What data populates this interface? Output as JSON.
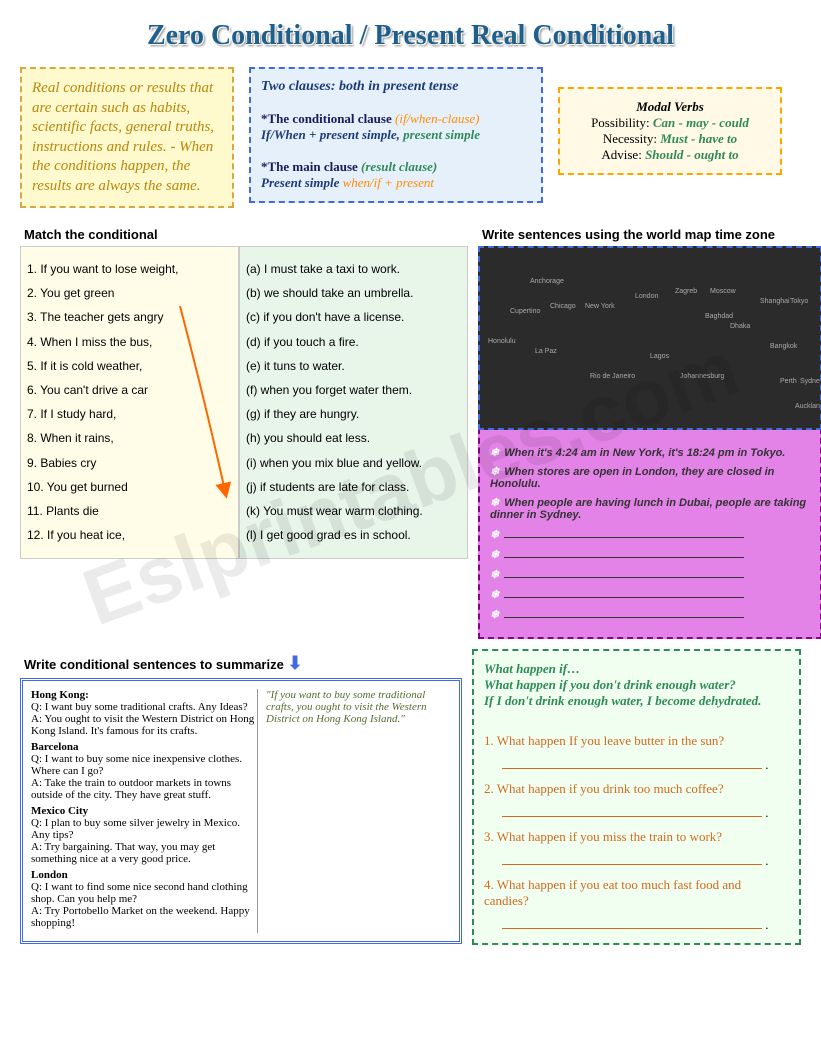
{
  "title": "Zero Conditional / Present Real Conditional",
  "intro": "Real conditions or results that are certain such as habits, scientific facts, general truths, instructions and rules.\n- When the conditions happen, the results are always the same.",
  "clauses": {
    "header": "Two clauses: both in present tense",
    "l1": "*The conditional clause ",
    "l1b": "(if/when-clause)",
    "l2": "If/When + present simple, ",
    "l2b": "present simple",
    "l3": "*The main clause ",
    "l3b": "(result clause)",
    "l4": "Present simple ",
    "l4b": "when/if + present"
  },
  "modal": {
    "title": "Modal Verbs",
    "p1": "Possibility: ",
    "p1v": "Can - may - could",
    "p2": "Necessity: ",
    "p2v": "Must - have to",
    "p3": "Advise: ",
    "p3v": "Should - ought to"
  },
  "match": {
    "header": "Match the conditional",
    "left": [
      "1.   If you want to lose weight,",
      "2.   You get green",
      "3.   The teacher gets angry",
      "4.   When I miss the bus,",
      "5.   If it is cold weather,",
      "6.   You can't drive a car",
      "7.   If I study hard,",
      "8.   When it rains,",
      "9.   Babies cry",
      "10. You get burned",
      "11. Plants die",
      "12. If you heat ice,"
    ],
    "right": [
      "(a)  I must take a taxi to work.",
      "(b)  we should take an umbrella.",
      "(c)  if you don't have a license.",
      "(d)  if you touch a fire.",
      "(e)  it tuns to water.",
      "(f)   when you forget water them.",
      "(g)  if they are hungry.",
      "(h)  you should eat less.",
      "(i)   when you mix blue and yellow.",
      "(j)   if students are late for class.",
      "(k)  You must wear warm clothing.",
      "(l)   I get good grad es in school."
    ]
  },
  "timezone": {
    "header": "Write sentences using the world map time zone",
    "examples": [
      "When it's 4:24 am in New York, it's 18:24 pm in Tokyo.",
      "When stores are open in London, they are closed in Honolulu.",
      "When people are having lunch in Dubai, people are taking dinner in Sydney."
    ]
  },
  "summarize": {
    "header": "Write conditional sentences to summarize",
    "example": "\"If you want to buy some traditional crafts, you ought to visit the Western District on Hong Kong Island.\"",
    "cities": [
      {
        "name": "Hong Kong:",
        "q": "Q: I want buy some traditional crafts. Any Ideas?",
        "a": "A: You ought to visit the Western District on Hong Kong Island. It's famous for its crafts."
      },
      {
        "name": "Barcelona",
        "q": "Q: I want to buy some nice inexpensive clothes. Where can I go?",
        "a": "A: Take the train to outdoor markets in towns outside of the city. They have great stuff."
      },
      {
        "name": "Mexico City",
        "q": "Q: I plan to buy some silver jewelry in Mexico. Any tips?",
        "a": "A: Try bargaining. That way, you may get something nice at a very good price."
      },
      {
        "name": "London",
        "q": "Q: I want to find some nice second hand clothing shop. Can you help me?",
        "a": "A: Try Portobello Market on the weekend. Happy shopping!"
      }
    ]
  },
  "whatif": {
    "title": "What happen if…",
    "ex1": "What happen if you don't drink enough water?",
    "ex2": "If I don't drink enough water, I become dehydrated.",
    "questions": [
      "1.  What happen If you leave butter in the sun?",
      "2.  What happen if you drink too much coffee?",
      "3.  What happen if you miss the train to work?",
      "4.  What happen if you eat too much fast food and candies?"
    ]
  },
  "watermark": "Eslprintables.com"
}
